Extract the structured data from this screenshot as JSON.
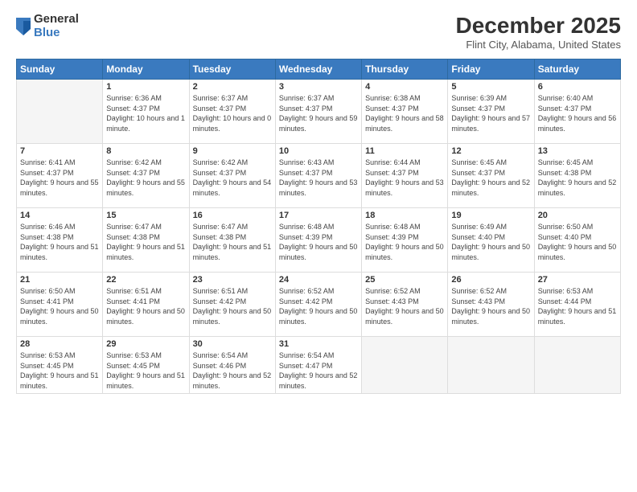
{
  "logo": {
    "general": "General",
    "blue": "Blue"
  },
  "header": {
    "month": "December 2025",
    "location": "Flint City, Alabama, United States"
  },
  "weekdays": [
    "Sunday",
    "Monday",
    "Tuesday",
    "Wednesday",
    "Thursday",
    "Friday",
    "Saturday"
  ],
  "weeks": [
    [
      {
        "day": "",
        "empty": true
      },
      {
        "day": "1",
        "sunrise": "6:36 AM",
        "sunset": "4:37 PM",
        "daylight": "10 hours and 1 minute."
      },
      {
        "day": "2",
        "sunrise": "6:37 AM",
        "sunset": "4:37 PM",
        "daylight": "10 hours and 0 minutes."
      },
      {
        "day": "3",
        "sunrise": "6:37 AM",
        "sunset": "4:37 PM",
        "daylight": "9 hours and 59 minutes."
      },
      {
        "day": "4",
        "sunrise": "6:38 AM",
        "sunset": "4:37 PM",
        "daylight": "9 hours and 58 minutes."
      },
      {
        "day": "5",
        "sunrise": "6:39 AM",
        "sunset": "4:37 PM",
        "daylight": "9 hours and 57 minutes."
      },
      {
        "day": "6",
        "sunrise": "6:40 AM",
        "sunset": "4:37 PM",
        "daylight": "9 hours and 56 minutes."
      }
    ],
    [
      {
        "day": "7",
        "sunrise": "6:41 AM",
        "sunset": "4:37 PM",
        "daylight": "9 hours and 55 minutes."
      },
      {
        "day": "8",
        "sunrise": "6:42 AM",
        "sunset": "4:37 PM",
        "daylight": "9 hours and 55 minutes."
      },
      {
        "day": "9",
        "sunrise": "6:42 AM",
        "sunset": "4:37 PM",
        "daylight": "9 hours and 54 minutes."
      },
      {
        "day": "10",
        "sunrise": "6:43 AM",
        "sunset": "4:37 PM",
        "daylight": "9 hours and 53 minutes."
      },
      {
        "day": "11",
        "sunrise": "6:44 AM",
        "sunset": "4:37 PM",
        "daylight": "9 hours and 53 minutes."
      },
      {
        "day": "12",
        "sunrise": "6:45 AM",
        "sunset": "4:37 PM",
        "daylight": "9 hours and 52 minutes."
      },
      {
        "day": "13",
        "sunrise": "6:45 AM",
        "sunset": "4:38 PM",
        "daylight": "9 hours and 52 minutes."
      }
    ],
    [
      {
        "day": "14",
        "sunrise": "6:46 AM",
        "sunset": "4:38 PM",
        "daylight": "9 hours and 51 minutes."
      },
      {
        "day": "15",
        "sunrise": "6:47 AM",
        "sunset": "4:38 PM",
        "daylight": "9 hours and 51 minutes."
      },
      {
        "day": "16",
        "sunrise": "6:47 AM",
        "sunset": "4:38 PM",
        "daylight": "9 hours and 51 minutes."
      },
      {
        "day": "17",
        "sunrise": "6:48 AM",
        "sunset": "4:39 PM",
        "daylight": "9 hours and 50 minutes."
      },
      {
        "day": "18",
        "sunrise": "6:48 AM",
        "sunset": "4:39 PM",
        "daylight": "9 hours and 50 minutes."
      },
      {
        "day": "19",
        "sunrise": "6:49 AM",
        "sunset": "4:40 PM",
        "daylight": "9 hours and 50 minutes."
      },
      {
        "day": "20",
        "sunrise": "6:50 AM",
        "sunset": "4:40 PM",
        "daylight": "9 hours and 50 minutes."
      }
    ],
    [
      {
        "day": "21",
        "sunrise": "6:50 AM",
        "sunset": "4:41 PM",
        "daylight": "9 hours and 50 minutes."
      },
      {
        "day": "22",
        "sunrise": "6:51 AM",
        "sunset": "4:41 PM",
        "daylight": "9 hours and 50 minutes."
      },
      {
        "day": "23",
        "sunrise": "6:51 AM",
        "sunset": "4:42 PM",
        "daylight": "9 hours and 50 minutes."
      },
      {
        "day": "24",
        "sunrise": "6:52 AM",
        "sunset": "4:42 PM",
        "daylight": "9 hours and 50 minutes."
      },
      {
        "day": "25",
        "sunrise": "6:52 AM",
        "sunset": "4:43 PM",
        "daylight": "9 hours and 50 minutes."
      },
      {
        "day": "26",
        "sunrise": "6:52 AM",
        "sunset": "4:43 PM",
        "daylight": "9 hours and 50 minutes."
      },
      {
        "day": "27",
        "sunrise": "6:53 AM",
        "sunset": "4:44 PM",
        "daylight": "9 hours and 51 minutes."
      }
    ],
    [
      {
        "day": "28",
        "sunrise": "6:53 AM",
        "sunset": "4:45 PM",
        "daylight": "9 hours and 51 minutes."
      },
      {
        "day": "29",
        "sunrise": "6:53 AM",
        "sunset": "4:45 PM",
        "daylight": "9 hours and 51 minutes."
      },
      {
        "day": "30",
        "sunrise": "6:54 AM",
        "sunset": "4:46 PM",
        "daylight": "9 hours and 52 minutes."
      },
      {
        "day": "31",
        "sunrise": "6:54 AM",
        "sunset": "4:47 PM",
        "daylight": "9 hours and 52 minutes."
      },
      {
        "day": "",
        "empty": true
      },
      {
        "day": "",
        "empty": true
      },
      {
        "day": "",
        "empty": true
      }
    ]
  ]
}
